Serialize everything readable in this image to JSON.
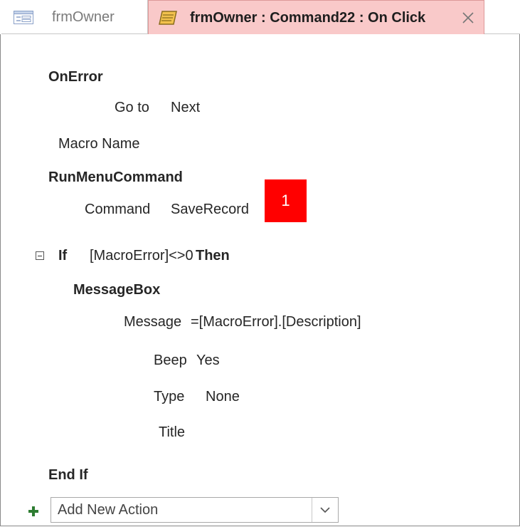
{
  "tabs": {
    "form_tab": "frmOwner",
    "macro_tab": "frmOwner : Command22 : On Click"
  },
  "macro": {
    "onerror_action": "OnError",
    "goto_label": "Go to",
    "goto_value": "Next",
    "macro_name_label": "Macro Name",
    "runmenu_action": "RunMenuCommand",
    "command_label": "Command",
    "command_value": "SaveRecord",
    "badge": "1",
    "if_keyword": "If",
    "if_condition": "[MacroError]<>0",
    "then_keyword": "Then",
    "msgbox_action": "MessageBox",
    "message_label": "Message",
    "message_value": "=[MacroError].[Description]",
    "beep_label": "Beep",
    "beep_value": "Yes",
    "type_label": "Type",
    "type_value": "None",
    "title_label": "Title",
    "endif": "End If",
    "add_new_action": "Add New Action"
  },
  "colors": {
    "active_tab": "#f9c9c9",
    "badge": "#ff0000",
    "plus_icon": "#2e7d32"
  }
}
